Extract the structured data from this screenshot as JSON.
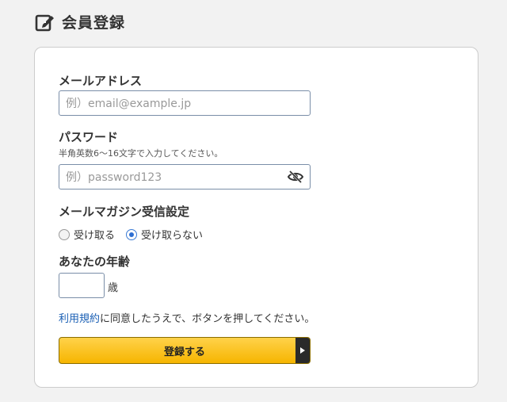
{
  "header": {
    "title": "会員登録",
    "icon": "edit-icon"
  },
  "form": {
    "email": {
      "label": "メールアドレス",
      "placeholder": "例）email@example.jp"
    },
    "password": {
      "label": "パスワード",
      "hint": "半角英数6〜16文字で入力してください。",
      "placeholder": "例）password123",
      "toggle_icon": "eye-slash-icon"
    },
    "newsletter": {
      "label": "メールマガジン受信設定",
      "options": [
        {
          "label": "受け取る",
          "checked": false
        },
        {
          "label": "受け取らない",
          "checked": true
        }
      ]
    },
    "age": {
      "label": "あなたの年齢",
      "value": "",
      "unit": "歳"
    },
    "terms": {
      "link": "利用規約",
      "text": "に同意したうえで、ボタンを押してください。"
    },
    "submit_label": "登録する"
  },
  "colors": {
    "accent": "#f6b500",
    "link": "#1a5fb4",
    "radio": "#2e6fd2"
  }
}
